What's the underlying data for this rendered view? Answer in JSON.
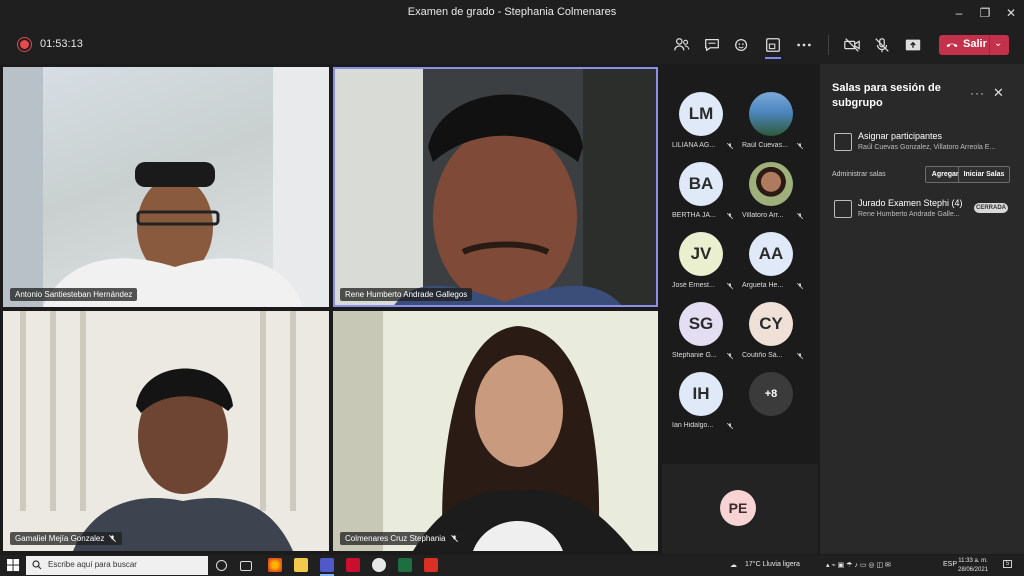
{
  "window": {
    "title": "Examen de grado - Stephania Colmenares",
    "minimize": "–",
    "restore": "❐",
    "close": "✕"
  },
  "toolbar": {
    "timer": "01:53:13",
    "leave_label": "Salir"
  },
  "tiles": [
    {
      "name": "Antonio Santiesteban Hernández"
    },
    {
      "name": "Rene Humberto Andrade Gallegos"
    },
    {
      "name": "Gamaliel Mejía Gonzalez"
    },
    {
      "name": "Colmenares Cruz Stephania"
    }
  ],
  "participants": [
    {
      "initials": "LM",
      "name": "LILIANA AG...",
      "bg": "#dfe9f7"
    },
    {
      "initials": "",
      "name": "Raúl Cuevas...",
      "bg": "#4a86c5"
    },
    {
      "initials": "BA",
      "name": "BERTHA JA...",
      "bg": "#dfe9f7"
    },
    {
      "initials": "",
      "name": "Villatoro Arr...",
      "bg": "#c9b199"
    },
    {
      "initials": "JV",
      "name": "José Ernest...",
      "bg": "#eaf0cf"
    },
    {
      "initials": "AA",
      "name": "Argueta He...",
      "bg": "#dfe9f7"
    },
    {
      "initials": "SG",
      "name": "Stephanie G...",
      "bg": "#e4def3"
    },
    {
      "initials": "CY",
      "name": "Coutiño Sá...",
      "bg": "#efe1d8"
    },
    {
      "initials": "IH",
      "name": "Ian Hidalgo...",
      "bg": "#dfe9f7"
    },
    {
      "initials": "+8",
      "name": "",
      "bg": "#3b3b3b"
    }
  ],
  "self_initials": "PE",
  "panel": {
    "title": "Salas para sesión de subgrupo",
    "assign_title": "Asignar participantes",
    "assign_sub": "Raúl Cuevas Gonzalez, Villatoro Arreola E...",
    "manage_label": "Administrar salas",
    "add_room": "Agregar sala",
    "start_rooms": "Iniciar Salas",
    "room_title": "Jurado Examen Stephi (4)",
    "room_sub": "Rene Humberto Andrade Galle...",
    "room_status": "CERRADA"
  },
  "taskbar": {
    "search_placeholder": "Escribe aquí para buscar",
    "weather": "17°C  Lluvia ligera",
    "lang": "ESP",
    "time": "11:33 a. m.",
    "date": "28/06/2021",
    "notif": "5"
  },
  "colors": {
    "accent": "#7f85f5",
    "leave": "#c4314b",
    "panel_bg": "#292929"
  }
}
